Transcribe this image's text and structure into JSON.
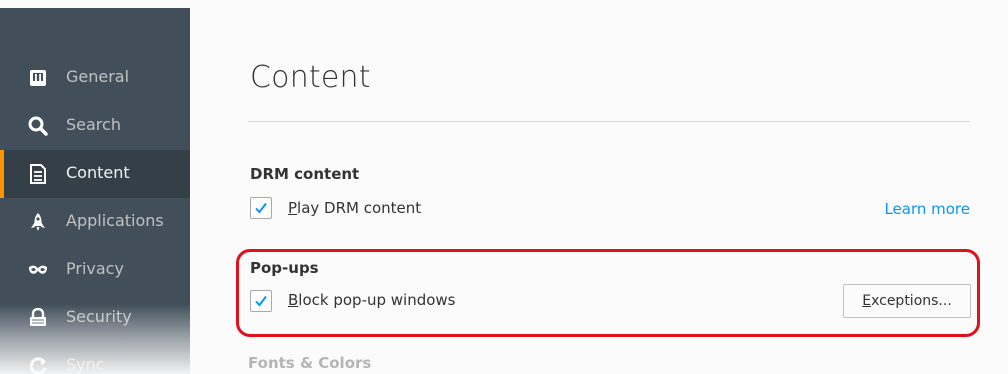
{
  "sidebar": {
    "items": [
      {
        "label": "General",
        "icon": "general-icon",
        "selected": false
      },
      {
        "label": "Search",
        "icon": "search-icon",
        "selected": false
      },
      {
        "label": "Content",
        "icon": "document-icon",
        "selected": true
      },
      {
        "label": "Applications",
        "icon": "rocket-icon",
        "selected": false
      },
      {
        "label": "Privacy",
        "icon": "mask-icon",
        "selected": false
      },
      {
        "label": "Security",
        "icon": "lock-icon",
        "selected": false
      },
      {
        "label": "Sync",
        "icon": "sync-icon",
        "selected": false
      }
    ]
  },
  "main": {
    "title": "Content",
    "sections": {
      "drm": {
        "heading": "DRM content",
        "checkbox_mnemonic": "P",
        "checkbox_rest": "lay DRM content",
        "checked": true,
        "link": "Learn more"
      },
      "popups": {
        "heading": "Pop-ups",
        "checkbox_mnemonic": "B",
        "checkbox_rest": "lock pop-up windows",
        "checked": true,
        "button_mnemonic": "E",
        "button_rest": "xceptions..."
      },
      "fonts": {
        "heading": "Fonts & Colors"
      }
    }
  },
  "colors": {
    "sidebar_bg": "#424f5a",
    "sidebar_selected_bg": "#343f48",
    "accent_orange": "#ff9500",
    "link_blue": "#0996f8",
    "checkmark_blue": "#0996f8",
    "highlight_red": "#e0101c"
  }
}
